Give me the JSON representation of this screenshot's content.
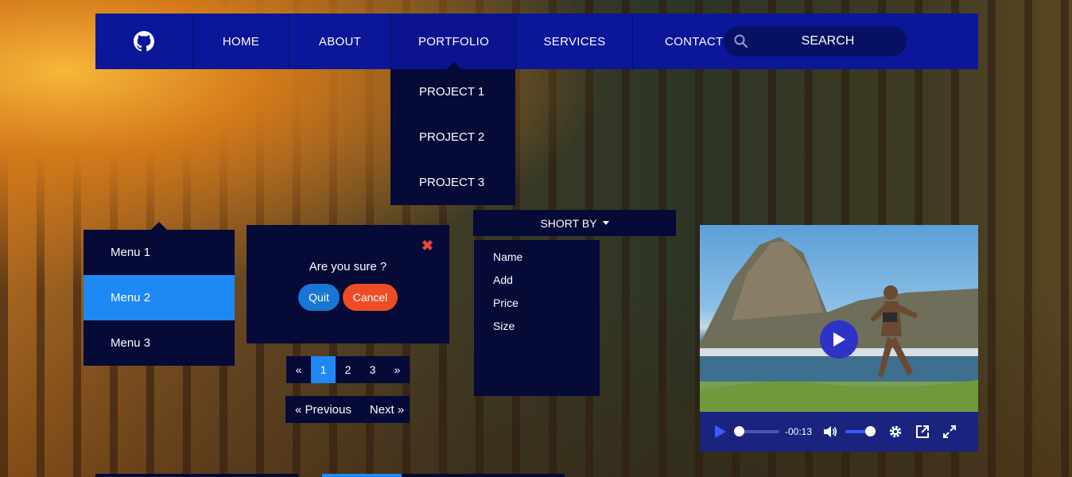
{
  "nav": {
    "items": [
      {
        "label": "HOME"
      },
      {
        "label": "ABOUT"
      },
      {
        "label": "PORTFOLIO"
      },
      {
        "label": "SERVICES"
      },
      {
        "label": "CONTACT"
      }
    ],
    "search_placeholder": "SEARCH"
  },
  "portfolio_dropdown": [
    "PROJECT 1",
    "PROJECT 2",
    "PROJECT 3"
  ],
  "side_menu": [
    "Menu 1",
    "Menu 2",
    "Menu 3"
  ],
  "modal": {
    "message": "Are you sure ?",
    "quit_label": "Quit",
    "cancel_label": "Cancel",
    "close_symbol": "✖"
  },
  "pagination": {
    "prev": "«",
    "pages": [
      "1",
      "2",
      "3"
    ],
    "next": "»"
  },
  "pager": {
    "previous": "« Previous",
    "next": "Next »"
  },
  "sort": {
    "label": "SHORT BY",
    "options": [
      "Name",
      "Add",
      "Price",
      "Size"
    ]
  },
  "video": {
    "time": "-00:13"
  },
  "colors": {
    "nav": "#0b1699",
    "panel": "#050a36",
    "accent": "#1e88f5",
    "cancel": "#ee4c27",
    "quit": "#1976d2"
  }
}
